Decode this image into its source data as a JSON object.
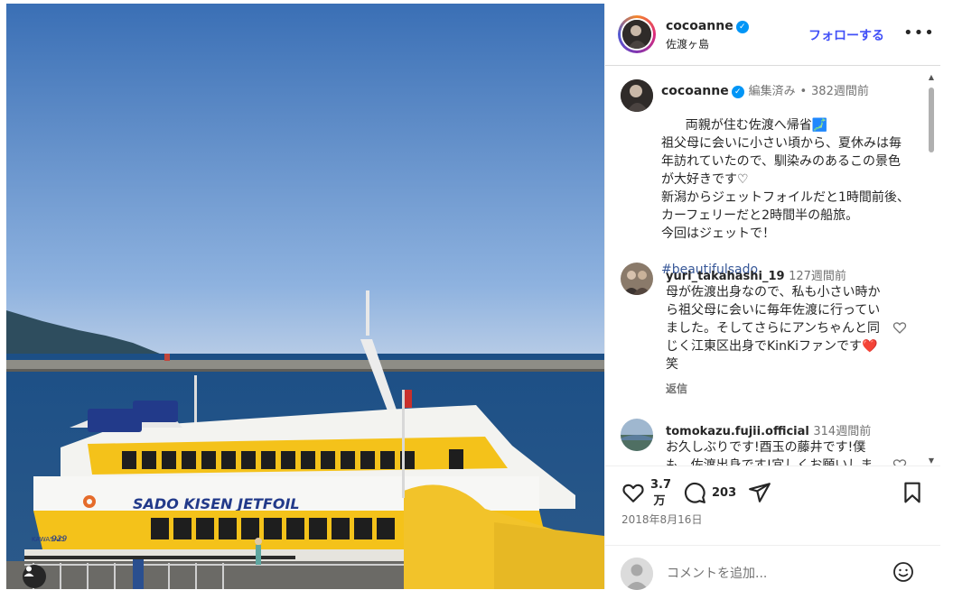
{
  "post": {
    "username": "cocoanne",
    "location": "佐渡ヶ島",
    "follow_label": "フォローする",
    "more_label": "•••",
    "verified_mark": "✓"
  },
  "caption": {
    "username": "cocoanne",
    "edited": "編集済み",
    "separator": "•",
    "time": "382週間前",
    "text": "両親が住む佐渡へ帰省🗾\n祖父母に会いに小さい頃から、夏休みは毎年訪れていたので、馴染みのあるこの景色が大好きです♡\n新潟からジェットフォイルだと1時間前後、カーフェリーだと2時間半の船旅。\n今回はジェットで！",
    "hashtag": "#beautifulsado"
  },
  "comments": [
    {
      "username": "yuri_takahashi_19",
      "time": "127週間前",
      "text": "母が佐渡出身なので、私も小さい時から祖父母に会いに毎年佐渡に行っていました。そしてさらにアンちゃんと同じく江東区出身でKinKiファンです❤️笑",
      "reply": "返信"
    },
    {
      "username": "tomokazu.fujii.official",
      "time": "314週間前",
      "text": "お久しぶりです!酉玉の藤井です!僕も、佐渡出身です!宜しくお願いします!"
    }
  ],
  "stats": {
    "likes": "3.7万",
    "likes_top": "3.7",
    "likes_bottom": "万",
    "comments": "203",
    "date": "2018年8月16日"
  },
  "add_comment": {
    "placeholder": "コメントを追加..."
  },
  "photo": {
    "ship_name": "SADO KISEN JETFOIL",
    "ship_number": "929",
    "ship_maker": "KAWASAKI"
  },
  "icons": {
    "verified": "verified-badge-icon",
    "more": "more-options-icon",
    "heart": "heart-icon",
    "comment": "comment-icon",
    "share": "share-icon",
    "save": "bookmark-icon",
    "emoji": "emoji-icon",
    "user_tag": "user-tag-icon"
  },
  "colors": {
    "accent": "#4150f7",
    "verified": "#0095f6",
    "hashtag": "#385898"
  }
}
